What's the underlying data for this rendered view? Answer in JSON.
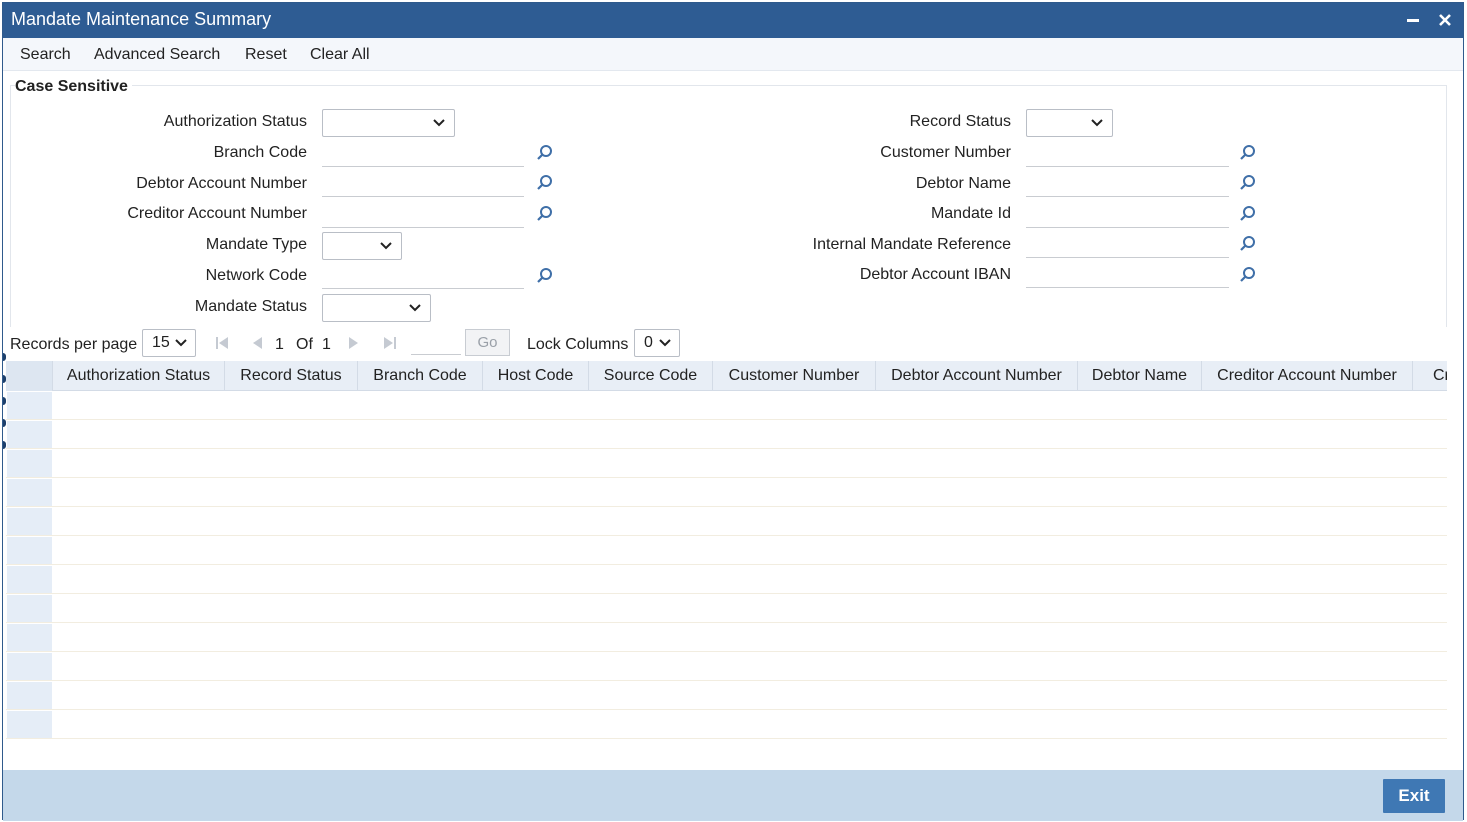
{
  "window": {
    "title": "Mandate Maintenance Summary",
    "minimize_label": "▬",
    "close_label": "✕"
  },
  "toolbar": {
    "search": "Search",
    "advanced_search": "Advanced Search",
    "reset": "Reset",
    "clear_all": "Clear All"
  },
  "criteria": {
    "section_label": "Case Sensitive",
    "left": [
      {
        "label": "Authorization Status",
        "type": "select",
        "value": ""
      },
      {
        "label": "Branch Code",
        "type": "lookup",
        "value": ""
      },
      {
        "label": "Debtor Account Number",
        "type": "lookup",
        "value": ""
      },
      {
        "label": "Creditor Account Number",
        "type": "lookup",
        "value": ""
      },
      {
        "label": "Mandate Type",
        "type": "select",
        "value": ""
      },
      {
        "label": "Network Code",
        "type": "lookup",
        "value": ""
      },
      {
        "label": "Mandate Status",
        "type": "select",
        "value": ""
      }
    ],
    "right": [
      {
        "label": "Record Status",
        "type": "select",
        "value": ""
      },
      {
        "label": "Customer Number",
        "type": "lookup",
        "value": ""
      },
      {
        "label": "Debtor Name",
        "type": "lookup",
        "value": ""
      },
      {
        "label": "Mandate Id",
        "type": "lookup",
        "value": ""
      },
      {
        "label": "Internal Mandate Reference",
        "type": "lookup",
        "value": ""
      },
      {
        "label": "Debtor Account IBAN",
        "type": "lookup",
        "value": ""
      }
    ]
  },
  "pager": {
    "records_per_page_label": "Records per page",
    "records_per_page": "15",
    "current_page": "1",
    "of_label": "Of",
    "total_pages": "1",
    "go_label": "Go",
    "lock_columns_label": "Lock Columns",
    "lock_columns": "0"
  },
  "grid": {
    "columns": [
      "Authorization Status",
      "Record Status",
      "Branch Code",
      "Host Code",
      "Source Code",
      "Customer Number",
      "Debtor Account Number",
      "Debtor Name",
      "Creditor Account Number",
      "Cr"
    ],
    "rows": []
  },
  "footer": {
    "exit_label": "Exit"
  },
  "colors": {
    "title_bar": "#2e5c93",
    "footer": "#c4d8ea",
    "exit_button": "#3f78b4",
    "grid_header": "#e8eef6"
  }
}
